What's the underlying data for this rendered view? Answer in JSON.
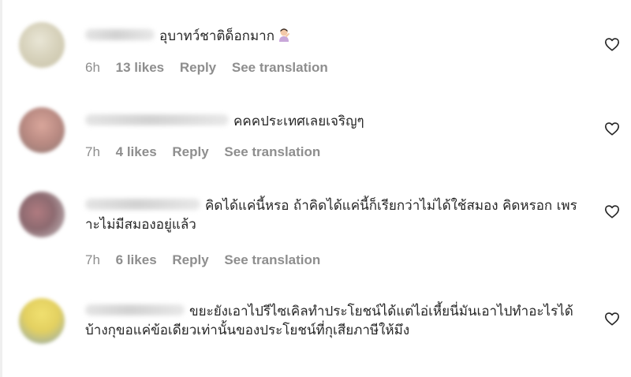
{
  "comments": [
    {
      "text": "อุบาทว์ชาติด็อกมาก",
      "emoji": "person-gesturing-emoji",
      "time": "6h",
      "likes": "13 likes",
      "reply": "Reply",
      "see_translation": "See translation"
    },
    {
      "text": "คคคประเทศเลยเจริญๆ",
      "time": "7h",
      "likes": "4 likes",
      "reply": "Reply",
      "see_translation": "See translation"
    },
    {
      "text": "คิดได้แค่นี้หรอ ถ้าคิดได้แค่นี้ก็เรียกว่าไม่ได้ใช้สมอง คิดหรอก เพราะไม่มีสมองอยู่แล้ว",
      "time": "7h",
      "likes": "6 likes",
      "reply": "Reply",
      "see_translation": "See translation"
    },
    {
      "text": "ขยะยังเอาไปรีไซเคิลทำประโยชน์ได้แต่ไอ่เหี้ยนี่มันเอาไปทำอะไรได้บ้างกุขอแค่ข้อเดียวเท่านั้นของประโยชน์ที่กุเสียภาษีให้มึง"
    }
  ],
  "icons": {
    "like": "heart-outline-icon"
  },
  "colors": {
    "text": "#262626",
    "meta": "#8e8e8e"
  }
}
